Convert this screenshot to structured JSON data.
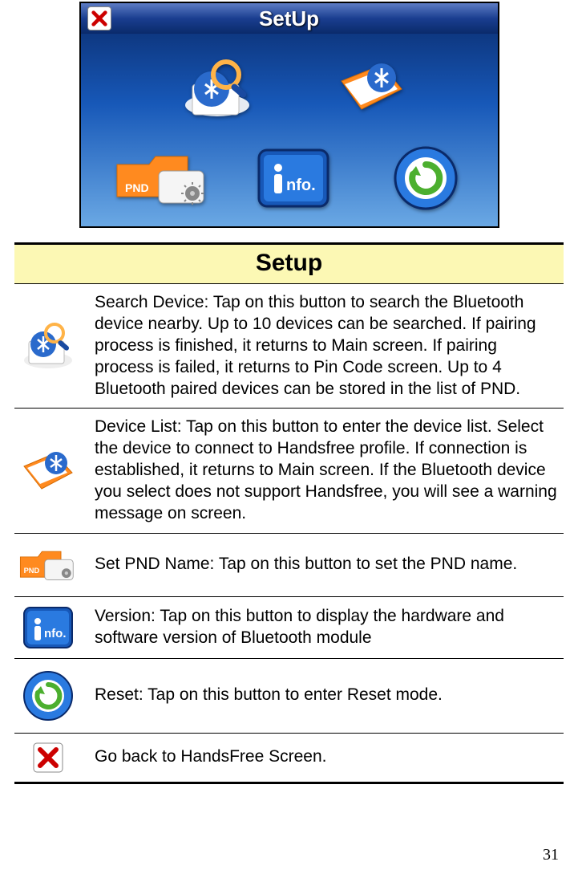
{
  "device_title": "SetUp",
  "section_title": "Setup",
  "rows": {
    "search": "Search Device: Tap on this button to search the Bluetooth device nearby. Up to 10 devices can be searched. If pairing process is finished, it returns to Main screen. If pairing process is failed, it returns to Pin Code screen. Up to 4 Bluetooth paired devices can be stored in the list of PND.",
    "devlist": "Device List: Tap on this button to enter the device list. Select the device to connect to Handsfree profile. If connection is established, it returns to Main screen. If the Bluetooth device you select does not support Handsfree, you will see a warning message on screen.",
    "pnd": "Set PND Name: Tap on this button to set the PND name.",
    "info": "Version: Tap on this button to display the hardware and software version of Bluetooth module",
    "reset": "Reset: Tap on this button to enter Reset mode.",
    "close": "Go back to HandsFree Screen."
  },
  "page_number": "31"
}
